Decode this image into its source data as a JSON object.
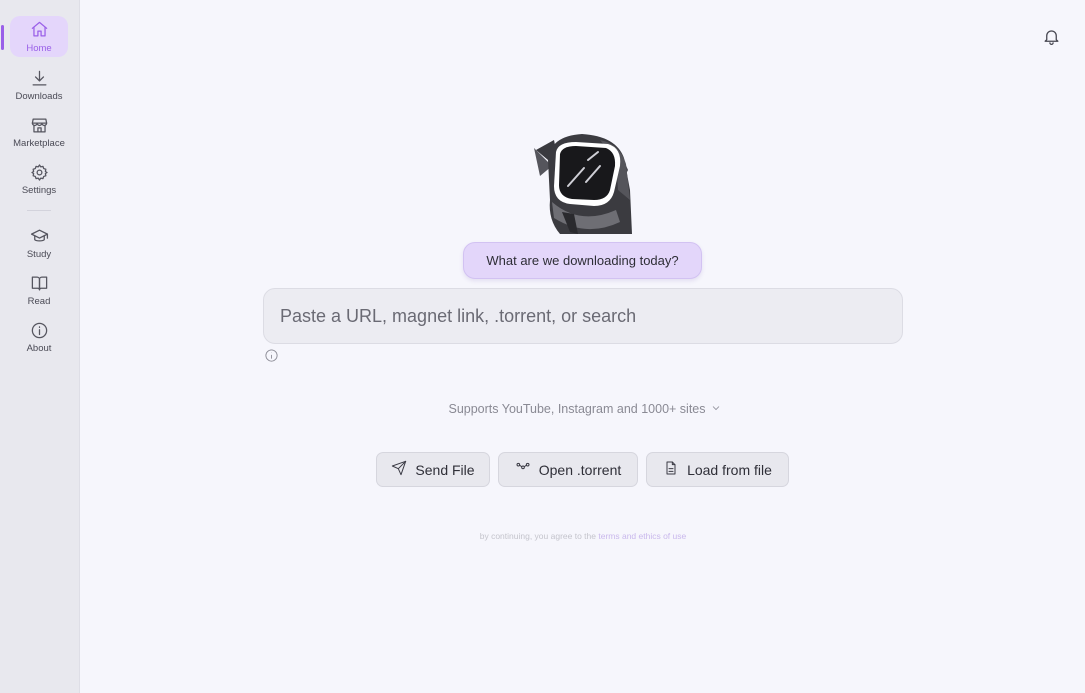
{
  "sidebar": {
    "items": [
      {
        "label": "Home",
        "icon": "home-icon",
        "active": true
      },
      {
        "label": "Downloads",
        "icon": "download-icon"
      },
      {
        "label": "Marketplace",
        "icon": "store-icon"
      },
      {
        "label": "Settings",
        "icon": "gear-icon"
      },
      {
        "label": "Study",
        "icon": "graduation-cap-icon"
      },
      {
        "label": "Read",
        "icon": "book-icon"
      },
      {
        "label": "About",
        "icon": "info-icon"
      }
    ]
  },
  "header": {
    "notifications_icon": "bell-icon"
  },
  "main": {
    "bubble_text": "What are we downloading today?",
    "search_placeholder": "Paste a URL, magnet link, .torrent, or search",
    "supports_text": "Supports YouTube, Instagram and 1000+ sites",
    "buttons": {
      "send_file": "Send File",
      "open_torrent": "Open .torrent",
      "load_from_file": "Load from file"
    },
    "terms": {
      "prefix": "by continuing, you agree to the",
      "link": "terms and ethics of use"
    }
  },
  "colors": {
    "accent": "#9a60e8",
    "active_bg": "#e4d6fb",
    "background": "#f6f6fc",
    "sidebar_bg": "#e8e8ee"
  }
}
